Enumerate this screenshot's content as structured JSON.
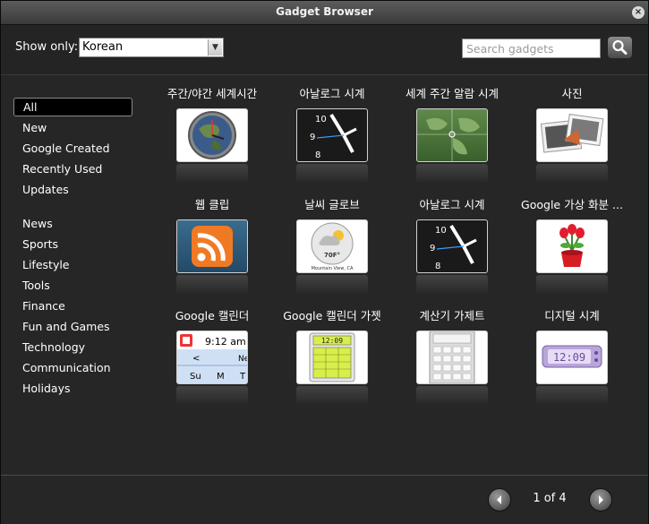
{
  "window": {
    "title": "Gadget Browser"
  },
  "filter": {
    "label": "Show only:",
    "selected": "Korean",
    "search_placeholder": "Search gadgets"
  },
  "sidebar": {
    "items": [
      "All",
      "New",
      "Google Created",
      "Recently Used",
      "Updates"
    ],
    "categories": [
      "News",
      "Sports",
      "Lifestyle",
      "Tools",
      "Finance",
      "Fun and Games",
      "Technology",
      "Communication",
      "Holidays"
    ]
  },
  "gadgets": [
    {
      "title": "주간/야간 세계시간",
      "icon": "world-clock-icon"
    },
    {
      "title": "아날로그 시계",
      "icon": "analog-clock-icon"
    },
    {
      "title": "세계 주간 알람 시계",
      "icon": "world-alarm-clock-icon"
    },
    {
      "title": "사진",
      "icon": "photos-icon"
    },
    {
      "title": "웹 클립",
      "icon": "rss-icon"
    },
    {
      "title": "날씨 글로브",
      "icon": "weather-globe-icon"
    },
    {
      "title": "아날로그 시계",
      "icon": "analog-clock-icon"
    },
    {
      "title": "Google 가상 화분 ...",
      "icon": "flower-pot-icon"
    },
    {
      "title": "Google 캘린더",
      "icon": "calendar-icon"
    },
    {
      "title": "Google 캘린더 가젯",
      "icon": "calendar-gadget-icon"
    },
    {
      "title": "계산기 가제트",
      "icon": "calculator-icon"
    },
    {
      "title": "디지털 시계",
      "icon": "digital-clock-icon"
    }
  ],
  "thumb_text": {
    "clock_10": "10",
    "clock_9": "9",
    "clock_8": "8",
    "weather_temp": "70F°",
    "weather_place": "Mountain View, CA",
    "cal_time": "9:12 am",
    "cal_prev": "<",
    "cal_next_partial": "Ne",
    "cal_days": [
      "Su",
      "M",
      "T"
    ],
    "calgadget_time": "12:09",
    "digital_time": "12:09"
  },
  "pager": {
    "text": "1 of 4"
  }
}
